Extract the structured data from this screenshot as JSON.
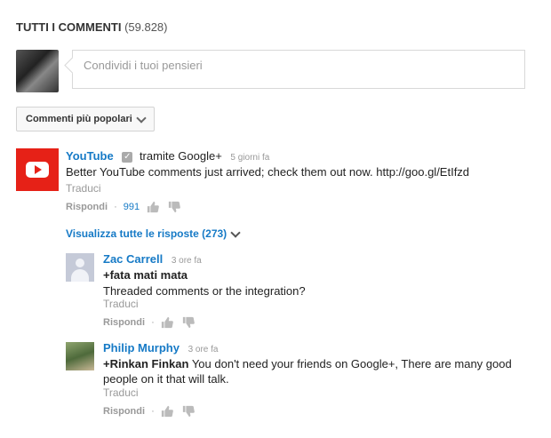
{
  "header": {
    "title": "TUTTI I COMMENTI",
    "count": "(59.828)"
  },
  "share": {
    "placeholder": "Condividi i tuoi pensieri"
  },
  "sort": {
    "label": "Commenti più popolari"
  },
  "comments": [
    {
      "author": "YouTube",
      "via": "tramite Google+",
      "time": "5 giorni fa",
      "text": "Better YouTube comments just arrived; check them out now. http://goo.gl/EtIfzd",
      "translate": "Traduci",
      "reply": "Rispondi",
      "likes": "991",
      "view_replies": "Visualizza tutte le risposte (273)"
    }
  ],
  "replies": [
    {
      "author": "Zac Carrell",
      "time": "3 ore fa",
      "mention": "+fata mati mata",
      "text": "Threaded comments or the integration?",
      "translate": "Traduci",
      "reply": "Rispondi"
    },
    {
      "author": "Philip Murphy",
      "time": "3 ore fa",
      "mention": "+Rinkan Finkan",
      "text_line1": " You don't need your friends on Google+, There are many good",
      "text_line2": "people on it that will talk.",
      "translate": "Traduci",
      "reply": "Rispondi"
    }
  ],
  "colors": {
    "link": "#167ac6",
    "brand": "#e62117",
    "muted": "#999999"
  }
}
